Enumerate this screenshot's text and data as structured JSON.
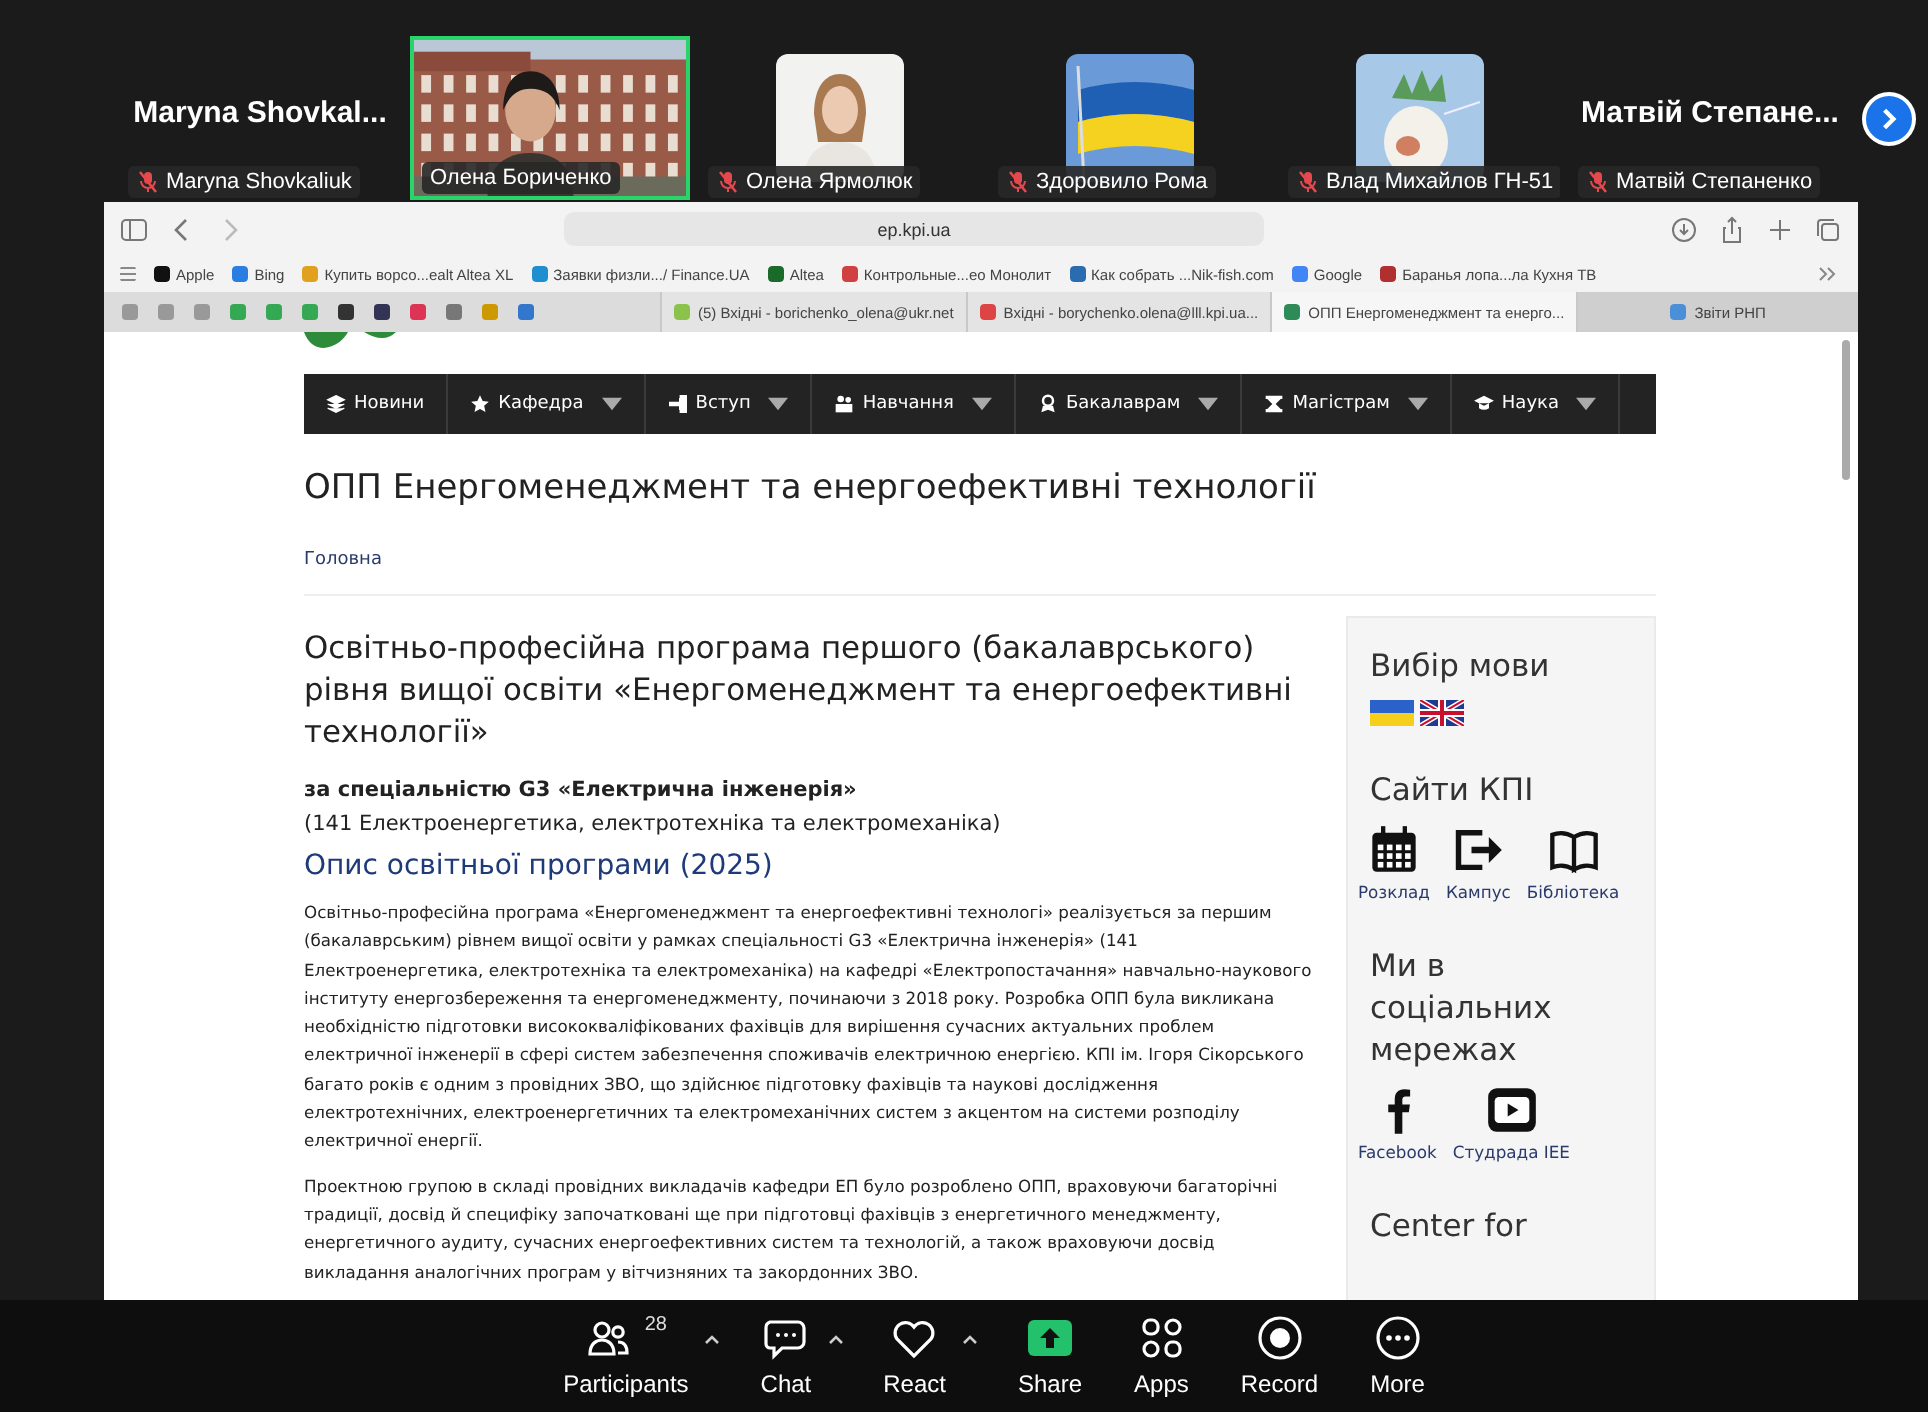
{
  "meeting": {
    "tiles": [
      {
        "kind": "name",
        "name": "Maryna  Shovkal...",
        "label": "Maryna Shovkaliuk",
        "muted": true,
        "speaking": false
      },
      {
        "kind": "video",
        "label": "Олена Бориченко",
        "muted": false,
        "speaking": true
      },
      {
        "label": "Олена Ярмолюк",
        "muted": true,
        "speaking": false
      },
      {
        "kind": "flag",
        "label": "Здоровило Рома",
        "muted": true,
        "speaking": false
      },
      {
        "kind": "avatar",
        "label": "Влад Михайлов ГН-51",
        "muted": true,
        "speaking": false
      },
      {
        "kind": "name",
        "name": "Матвій  Степане...",
        "label": "Матвій Степаненко",
        "muted": true,
        "speaking": false
      }
    ]
  },
  "browser": {
    "url": "ep.kpi.ua",
    "bookmarks": [
      "Apple",
      "Bing",
      "Купить ворсо...ealt Altea XL",
      "Заявки физли.../ Finance.UA",
      "Altea",
      "Контрольные...ео Монолит",
      "Как собрать ...Nik-fish.com",
      "Google",
      "Баранья лопа...ла Кухня ТВ"
    ],
    "tabs": [
      {
        "label": "(5) Вхідні - borichenko_olena@ukr.net",
        "selected": false
      },
      {
        "label": "Вхідні - borychenko.olena@lll.kpi.ua...",
        "selected": false
      },
      {
        "label": "ОПП Енергоменеджмент та енерго...",
        "selected": true
      },
      {
        "label": "Звіти РНП",
        "selected": false
      }
    ]
  },
  "page": {
    "nav": [
      {
        "label": "Новини",
        "dropdown": false
      },
      {
        "label": "Кафедра",
        "dropdown": true
      },
      {
        "label": "Вступ",
        "dropdown": true
      },
      {
        "label": "Навчання",
        "dropdown": true
      },
      {
        "label": "Бакалаврам",
        "dropdown": true
      },
      {
        "label": "Магістрам",
        "dropdown": true
      },
      {
        "label": "Наука",
        "dropdown": true
      }
    ],
    "title": "ОПП Енергоменеджмент та енергоефективні технології",
    "breadcrumb": "Головна",
    "heading": "Освітньо-професійна програма першого (бакалаврського) рівня вищої освіти «Енергоменеджмент та енергоефективні технології»",
    "specialty": "за спеціальністю G3 «Електрична інженерія»",
    "specialty_note": "(141 Електроенергетика, електротехніка та електромеханіка)",
    "section_title": "Опис освітньої програми (2025)",
    "paragraphs": [
      "Освітньо-професійна програма «Енергоменеджмент та енергоефективні технологі» реалізується за першим (бакалаврським) рівнем вищої освіти у рамках спеціальності G3 «Електрична інженерія» (141 Електроенергетика, електротехніка та електромеханіка) на кафедрі «Електропостачання» навчально-наукового інституту енергозбереження та енергоменеджменту, починаючи з 2018 року. Розробка ОПП була викликана необхідністю підготовки висококваліфікованих фахівців для вирішення сучасних актуальних проблем електричної інженерії в сфері систем забезпечення споживачів електричною енергією. КПІ ім. Ігоря Сікорського багато років є одним з провідних ЗВО, що здійснює підготовку фахівців та наукові дослідження електротехнічних, електроенергетичних та електромеханічних систем з акцентом на системи розподілу електричної енергії.",
      "Проектною групою в складі провідних викладачів кафедри ЕП було розроблено ОПП, враховуючи багаторічні традиції, досвід й специфіку започатковані ще при підготовці фахівців з енергетичного менеджменту, енергетичного аудиту, сучасних енергоефективних систем та технологій, а також враховуючи досвід викладання аналогічних програм у вітчизняних та закордонних ЗВО."
    ],
    "sidebar": [
      {
        "kind": "languages",
        "title": "Вибір мови"
      },
      {
        "kind": "links",
        "title": "Сайти КПІ",
        "links": [
          {
            "kind": "calendar",
            "label": "Розклад"
          },
          {
            "kind": "login",
            "label": "Кампус"
          },
          {
            "kind": "book",
            "label": "Бібліотека"
          }
        ]
      },
      {
        "kind": "links",
        "title": "Ми в соціальних мережах",
        "links": [
          {
            "kind": "facebook",
            "label": "Facebook"
          },
          {
            "kind": "youtube",
            "label": "Студрада IEE"
          }
        ]
      },
      {
        "kind": "heading",
        "title": "Center for"
      }
    ]
  },
  "toolbar": [
    {
      "kind": "participants",
      "label": "Participants",
      "count": "28",
      "menu": true
    },
    {
      "kind": "chat",
      "label": "Chat",
      "menu": true
    },
    {
      "kind": "react",
      "label": "React",
      "menu": true
    },
    {
      "kind": "share",
      "label": "Share",
      "menu": false
    },
    {
      "kind": "apps",
      "label": "Apps",
      "menu": false
    },
    {
      "kind": "record",
      "label": "Record",
      "menu": false
    },
    {
      "kind": "more",
      "label": "More",
      "menu": false
    }
  ]
}
